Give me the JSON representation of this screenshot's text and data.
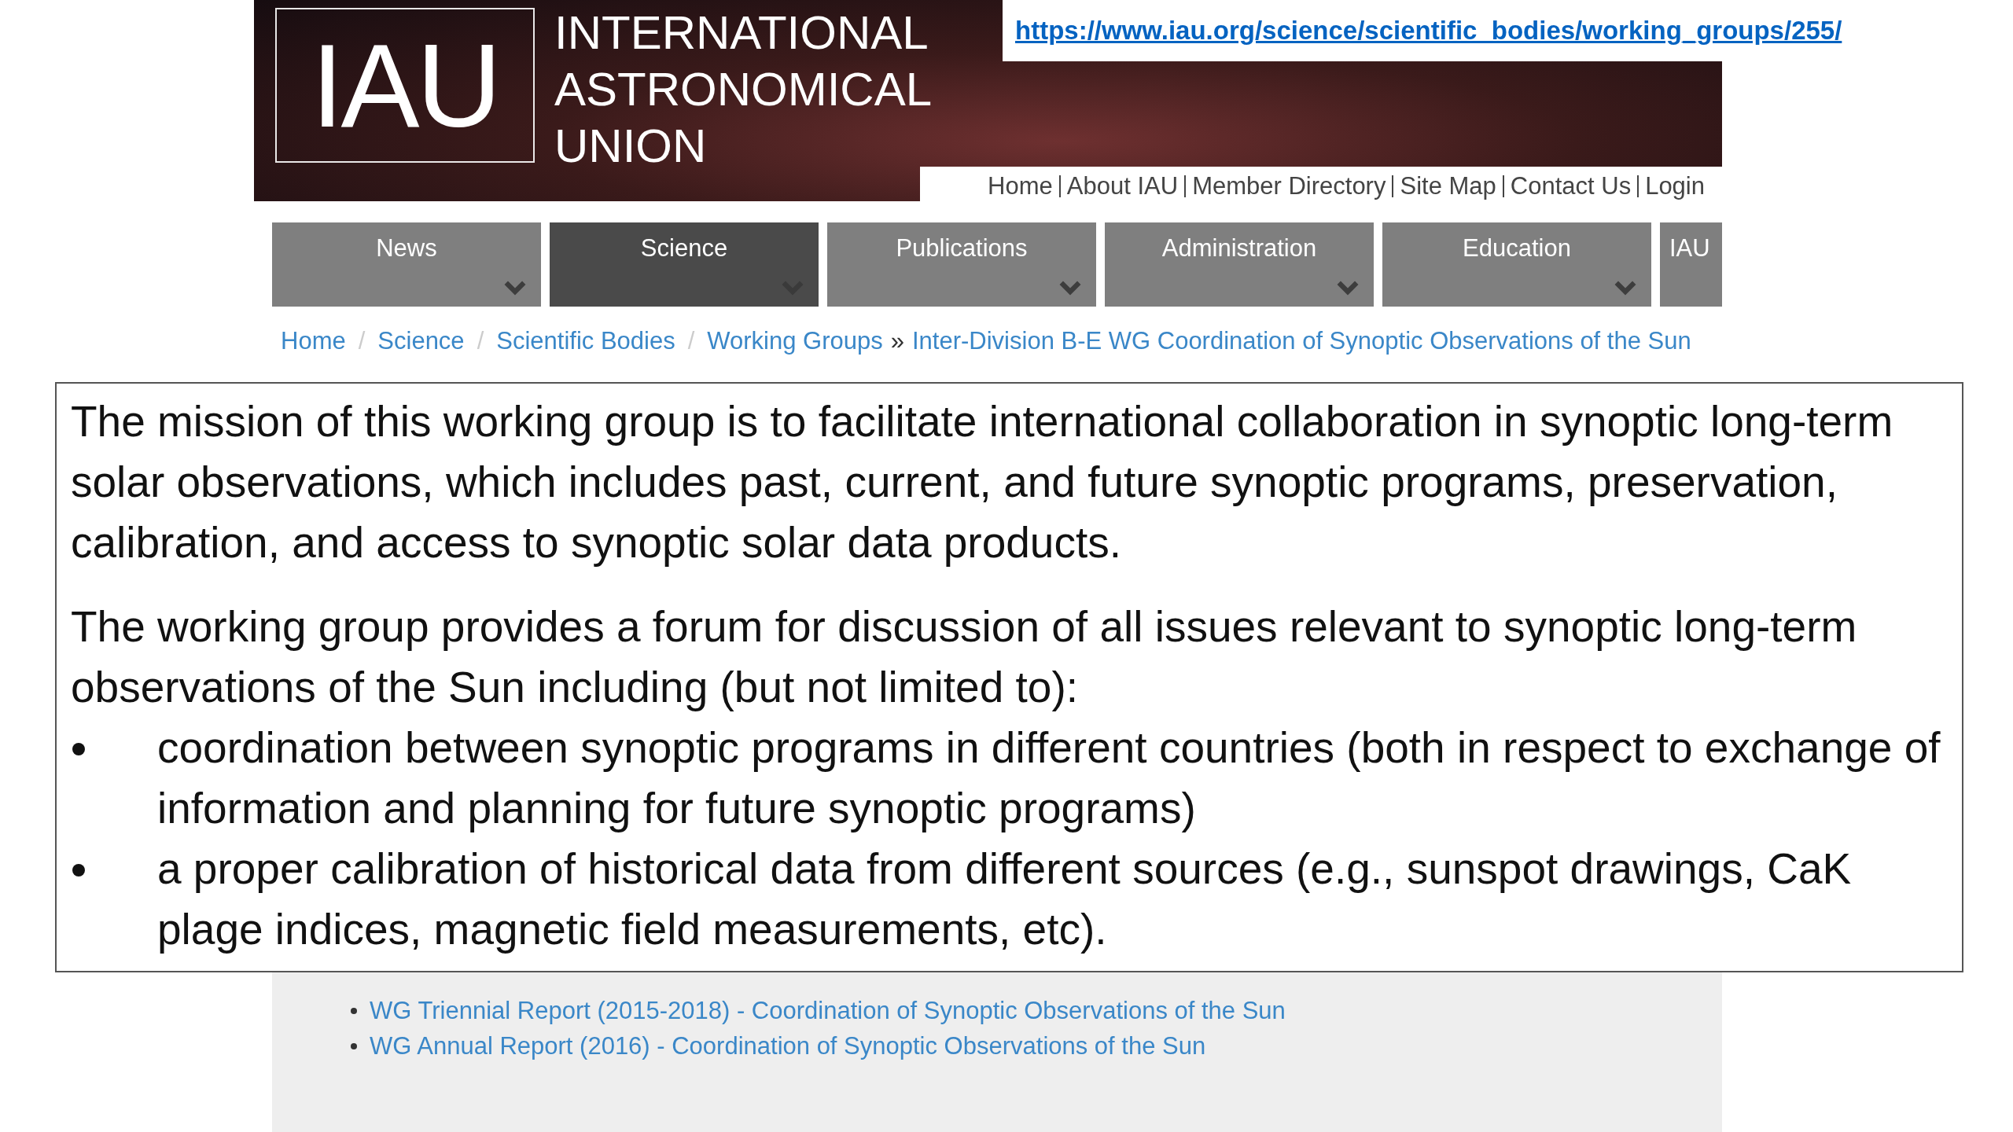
{
  "header": {
    "logo": "IAU",
    "title_lines": [
      "INTERNATIONAL",
      "ASTRONOMICAL",
      "UNION"
    ]
  },
  "url": "https://www.iau.org/science/scientific_bodies/working_groups/255/",
  "top_links": [
    "Home",
    "About IAU",
    "Member Directory",
    "Site Map",
    "Contact Us",
    "Login"
  ],
  "nav": [
    {
      "label": "News",
      "selected": false
    },
    {
      "label": "Science",
      "selected": true
    },
    {
      "label": "Publications",
      "selected": false
    },
    {
      "label": "Administration",
      "selected": false
    },
    {
      "label": "Education",
      "selected": false
    },
    {
      "label": "IAU",
      "selected": false
    }
  ],
  "breadcrumb": [
    "Home",
    "Science",
    "Scientific Bodies",
    "Working Groups",
    "Inter-Division B-E WG Coordination of Synoptic Observations of the Sun"
  ],
  "breadcrumb_separators": [
    "/",
    "/",
    "/",
    "»"
  ],
  "text_box": {
    "paragraphs": [
      "The mission of this working group is to facilitate international collaboration in synoptic long-term solar observations, which includes past, current, and future synoptic programs, preservation, calibration, and access to synoptic solar data products.",
      "The working group provides a forum for discussion of all issues relevant to synoptic long-term observations of the Sun including (but not limited to):"
    ],
    "bullets": [
      "coordination between synoptic programs in different countries (both in respect to exchange of information and planning for future synoptic programs)",
      "a proper calibration of historical data from different sources (e.g., sunspot drawings, CaK plage indices, magnetic field measurements, etc)."
    ]
  },
  "reports": [
    "WG Triennial Report (2015-2018) - Coordination of Synoptic Observations of the Sun",
    "WG Annual Report (2016) - Coordination of Synoptic Observations of the Sun"
  ]
}
